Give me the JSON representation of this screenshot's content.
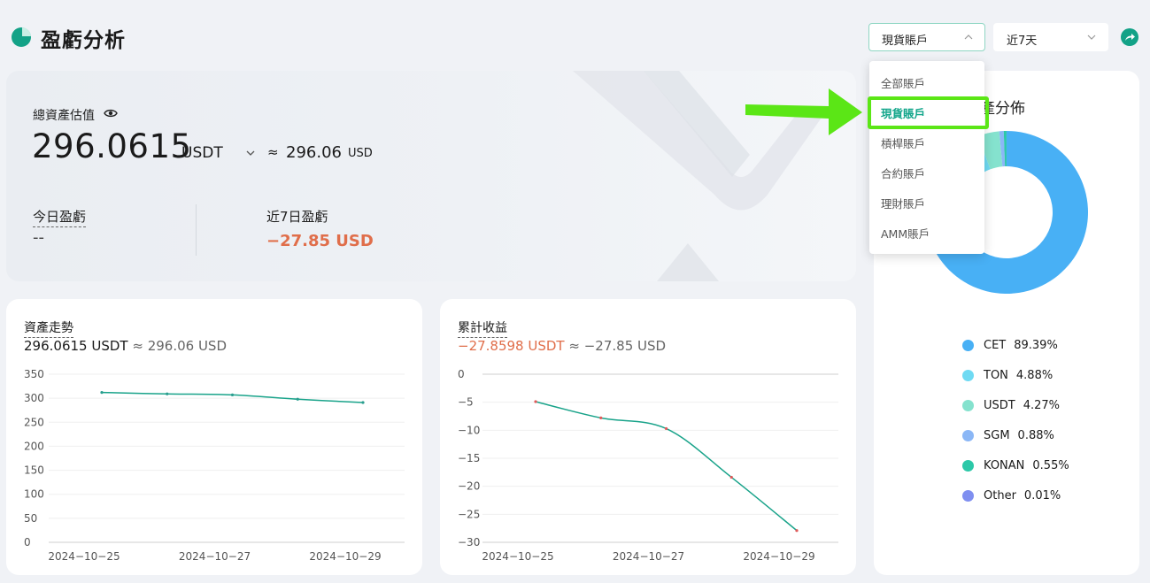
{
  "header": {
    "title": "盈虧分析",
    "account_select": "現貨賬戶",
    "period_select": "近7天"
  },
  "total": {
    "label": "總資產估值",
    "value": "296.0615",
    "unit": "USDT",
    "approx_symbol": "≈",
    "usd_value": "296.06",
    "usd_unit": "USD"
  },
  "pnl": {
    "today_label": "今日盈虧",
    "today_value": "--",
    "week_label": "近7日盈虧",
    "week_value": "−27.85 USD"
  },
  "asset_trend": {
    "title": "資產走勢",
    "main": "296.0615 USDT",
    "approx": "≈",
    "secondary": "296.06 USD"
  },
  "cumulative": {
    "title": "累計收益",
    "main": "−27.8598 USDT",
    "approx": "≈",
    "secondary": "−27.85 USD"
  },
  "distribution": {
    "title": "產分佈"
  },
  "dropdown": {
    "items": [
      "全部賬戶",
      "現貨賬戶",
      "槓桿賬戶",
      "合約賬戶",
      "理財賬戶",
      "AMM賬戶"
    ],
    "selected": 1
  },
  "colors": {
    "accent": "#11a58a",
    "negative": "#e06e4a",
    "highlight": "#5be616",
    "line": "#19a38a"
  },
  "chart_data": [
    {
      "type": "line",
      "title": "資產走勢",
      "x": [
        "2024-10-25",
        "2024-10-26",
        "2024-10-27",
        "2024-10-28",
        "2024-10-29"
      ],
      "x_ticks": [
        "2024−10−25",
        "2024−10−27",
        "2024−10−29"
      ],
      "values": [
        312,
        309,
        307,
        298,
        291
      ],
      "ylim": [
        0,
        350
      ],
      "y_ticks": [
        0,
        50,
        100,
        150,
        200,
        250,
        300,
        350
      ],
      "grid": true
    },
    {
      "type": "line",
      "title": "累計收益",
      "x": [
        "2024-10-25",
        "2024-10-26",
        "2024-10-27",
        "2024-10-28",
        "2024-10-29"
      ],
      "x_ticks": [
        "2024−10−25",
        "2024−10−27",
        "2024−10−29"
      ],
      "values": [
        -4.9,
        -7.8,
        -9.7,
        -18.4,
        -27.9
      ],
      "ylim": [
        -30,
        0
      ],
      "y_ticks": [
        0,
        -5,
        -10,
        -15,
        -20,
        -25,
        -30
      ],
      "grid": true
    },
    {
      "type": "pie",
      "title": "產分佈",
      "labels": [
        "CET",
        "TON",
        "USDT",
        "SGM",
        "KONAN",
        "Other"
      ],
      "values": [
        89.39,
        4.88,
        4.27,
        0.88,
        0.55,
        0.01
      ],
      "value_labels": [
        "89.39%",
        "4.88%",
        "4.27%",
        "0.88%",
        "0.55%",
        "0.01%"
      ],
      "colors": [
        "#48b0f5",
        "#6fdaf3",
        "#85e2ce",
        "#8bb7f6",
        "#2cc8a8",
        "#7f8ff0"
      ],
      "legend": "bottom"
    }
  ]
}
